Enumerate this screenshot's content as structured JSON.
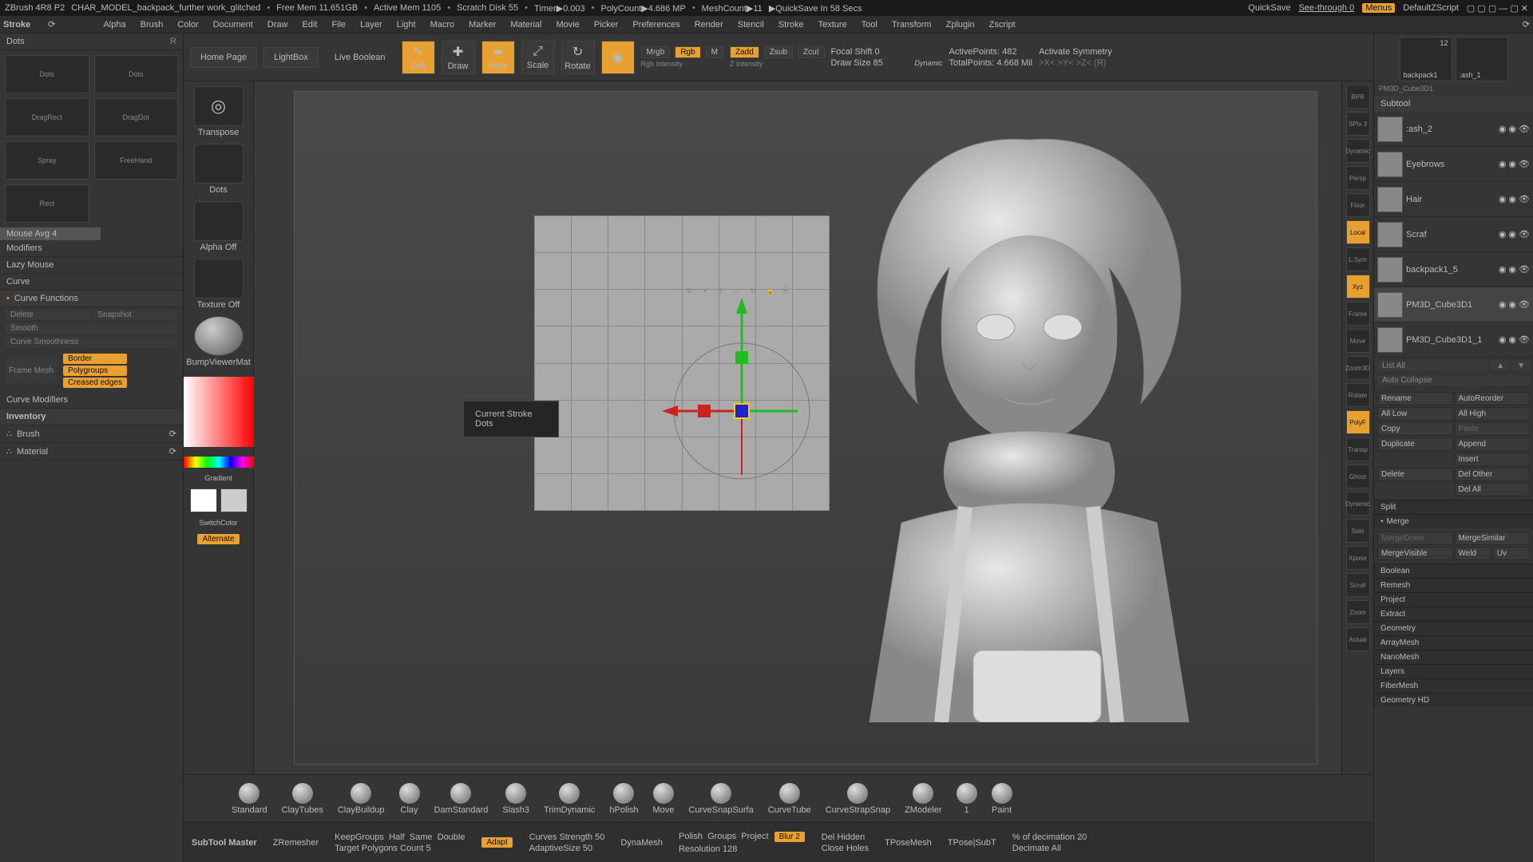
{
  "topbar": {
    "app": "ZBrush 4R8 P2",
    "doc": "CHAR_MODEL_backpack_further work_glitched",
    "freemem": "Free Mem 11.651GB",
    "activemem": "Active Mem 1105",
    "scratch": "Scratch Disk 55",
    "timer": "Timer▶0.003",
    "polycount": "PolyCount▶4.686 MP",
    "meshcount": "MeshCount▶11",
    "quicksave_msg": "▶QuickSave In 58 Secs",
    "quicksave_btn": "QuickSave",
    "seethrough": "See-through  0",
    "menus": "Menus",
    "defaultz": "DefaultZScript"
  },
  "panel_title": "Stroke",
  "menus": [
    "Alpha",
    "Brush",
    "Color",
    "Document",
    "Draw",
    "Edit",
    "File",
    "Layer",
    "Light",
    "Macro",
    "Marker",
    "Material",
    "Movie",
    "Picker",
    "Preferences",
    "Render",
    "Stencil",
    "Stroke",
    "Texture",
    "Tool",
    "Transform",
    "Zplugin",
    "Zscript"
  ],
  "stroke": {
    "header": "Dots",
    "cells": [
      "Dots",
      "Dots",
      "DragRect",
      "DragDot",
      "Spray",
      "FreeHand",
      "Rect"
    ],
    "mouse_avg": "Mouse Avg 4",
    "modifiers": "Modifiers",
    "lazy": "Lazy Mouse",
    "curve": "Curve",
    "curve_fn": "Curve Functions",
    "delete": "Delete",
    "snapshot": "Snapshot",
    "smooth": "Smooth",
    "curve_smooth": "Curve Smoothness",
    "frame_mesh": "Frame Mesh",
    "border": "Border",
    "polygroups": "Polygroups",
    "creased": "Creased edges",
    "curve_mod": "Curve Modifiers",
    "inventory": "Inventory",
    "brush": "Brush",
    "material": "Material"
  },
  "leftstrip": {
    "transpose": "Transpose",
    "dots": "Dots",
    "alpha": "Alpha Off",
    "texture": "Texture Off",
    "matname": "BumpViewerMat",
    "gradient": "Gradient",
    "switch": "SwitchColor",
    "alternate": "Alternate",
    "tooltip_l1": "Current Stroke",
    "tooltip_l2": "Dots"
  },
  "toolbar": {
    "home": "Home Page",
    "lightbox": "LightBox",
    "live": "Live Boolean",
    "edit": "Edit",
    "draw": "Draw",
    "move": "Move",
    "scale": "Scale",
    "rotate": "Rotate",
    "mrgb": "Mrgb",
    "rgb": "Rgb",
    "m": "M",
    "rgb_intensity": "Rgb Intensity",
    "zadd": "Zadd",
    "zsub": "Zsub",
    "zcut": "Zcut",
    "z_intensity": "Z Intensity",
    "focal": "Focal Shift 0",
    "drawsize": "Draw Size 85",
    "dynamic": "Dynamic",
    "active": "ActivePoints: 482",
    "total": "TotalPoints: 4.668 Mil",
    "sym": "Activate Symmetry",
    "axes": ">X<   >Y<   >Z<   (R)"
  },
  "vpright": [
    "BPR",
    "SPix 3",
    "Dynamic",
    "Persp",
    "Floor",
    "Local",
    "L.Sym",
    "Xyz",
    "Frame",
    "Move",
    "Zoom3D",
    "Rotate",
    "PolyF",
    "Transp",
    "Ghost",
    "Dynamic",
    "Solo",
    "Xpose",
    "Scroll",
    "Zoom",
    "Actual"
  ],
  "tooltiles": {
    "a": "backpack1",
    "anum": "12",
    "b": ":ash_1",
    "c": "PM3D_Cube3D1"
  },
  "subtool": {
    "header": "Subtool",
    "items": [
      ":ash_2",
      "Eyebrows",
      "Hair",
      "Scraf",
      "backpack1_5",
      "PM3D_Cube3D1",
      "PM3D_Cube3D1_1"
    ],
    "listall": "List All",
    "autocollapse": "Auto Collapse",
    "rename": "Rename",
    "autoreorder": "AutoReorder",
    "alllow": "All Low",
    "allhigh": "All High",
    "copy": "Copy",
    "paste": "Paste",
    "duplicate": "Duplicate",
    "append": "Append",
    "insert": "Insert",
    "delete": "Delete",
    "delother": "Del Other",
    "delall": "Del All",
    "split": "Split",
    "merge": "Merge",
    "mergedown": "MergeDown",
    "mergesimilar": "MergeSimilar",
    "mergevisible": "MergeVisible",
    "weld": "Weld",
    "uv": "Uv",
    "boolean": "Boolean",
    "remesh": "Remesh",
    "project": "Project",
    "extract": "Extract",
    "sections": [
      "Geometry",
      "ArrayMesh",
      "NanoMesh",
      "Layers",
      "FiberMesh",
      "Geometry HD"
    ]
  },
  "brushes": [
    "Standard",
    "ClayTubes",
    "ClayBuildup",
    "Clay",
    "DamStandard",
    "Slash3",
    "TrimDynamic",
    "hPolish",
    "Move",
    "CurveSnapSurfa",
    "CurveTube",
    "CurveStrapSnap",
    "ZModeler",
    "1",
    "Paint"
  ],
  "bottom": {
    "subtoolmaster": "SubTool Master",
    "zremesher": "ZRemesher",
    "keepgroups": "KeepGroups",
    "half": "Half",
    "same": "Same",
    "double": "Double",
    "target": "Target Polygons Count 5",
    "adapt": "Adapt",
    "curves": "Curves Strength 50",
    "adaptive": "AdaptiveSize 50",
    "dynamesh": "DynaMesh",
    "polish": "Polish",
    "groups": "Groups",
    "project_b": "Project",
    "blur": "Blur 2",
    "resolution": "Resolution 128",
    "delhidden": "Del Hidden",
    "closeholes": "Close Holes",
    "tposemesh": "TPoseMesh",
    "tposesubt": "TPose|SubT",
    "decimation": "% of decimation  20",
    "decimate": "Decimate All"
  }
}
